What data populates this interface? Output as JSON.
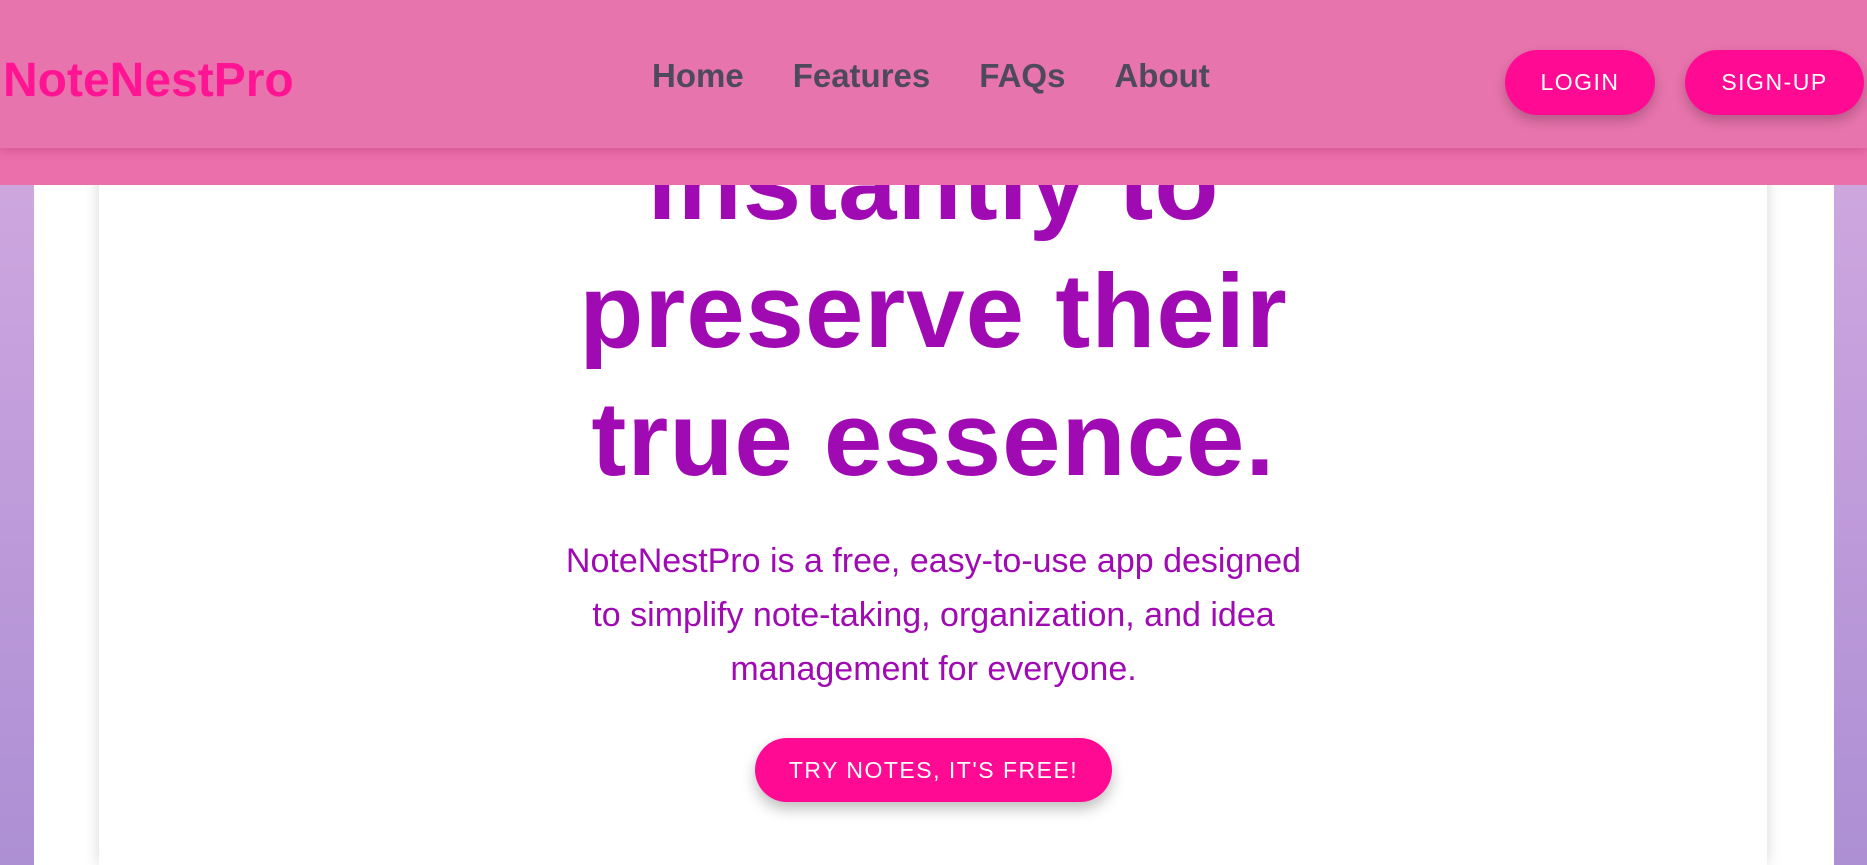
{
  "brand": {
    "name": "NoteNestPro"
  },
  "nav": {
    "links": [
      "Home",
      "Features",
      "FAQs",
      "About"
    ]
  },
  "auth": {
    "login_label": "LOGIN",
    "signup_label": "SIGN-UP"
  },
  "hero": {
    "heading_lines": [
      "instantly to",
      "preserve their",
      "true essence."
    ],
    "description": "NoteNestPro is a free, easy-to-use app designed to simplify note-taking, organization, and idea management for everyone.",
    "cta_label": "TRY NOTES, IT'S FREE!"
  },
  "colors": {
    "brand": "#ff1493",
    "accent_button": "#ff0a92",
    "heading": "#a00ab3",
    "navbar": "#e874ad",
    "nav_text": "#4e4a5b"
  }
}
